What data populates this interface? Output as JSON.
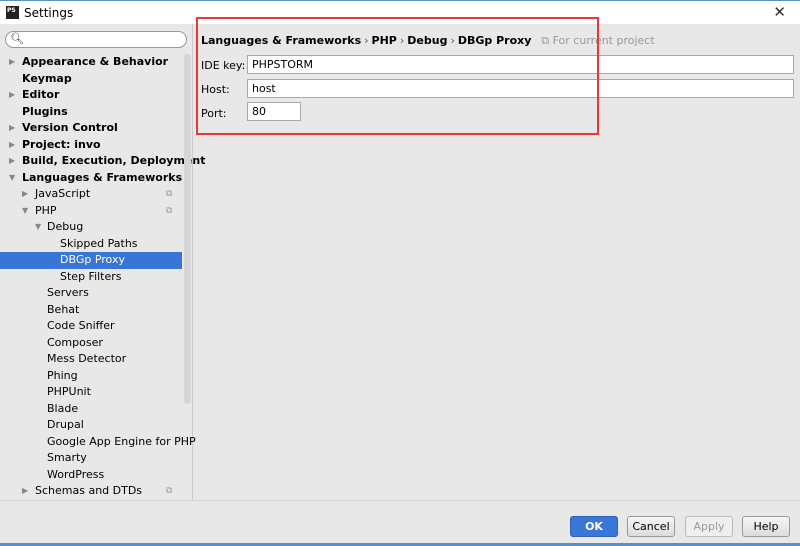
{
  "window": {
    "title": "Settings",
    "icon": "phpstorm-logo",
    "logo_text": "PS"
  },
  "sidebar": {
    "search": {
      "placeholder": "",
      "value": ""
    },
    "items": [
      {
        "label": "Appearance & Behavior",
        "level": 0,
        "bold": true,
        "arrow": "right"
      },
      {
        "label": "Keymap",
        "level": 0,
        "bold": true,
        "arrow": ""
      },
      {
        "label": "Editor",
        "level": 0,
        "bold": true,
        "arrow": "right"
      },
      {
        "label": "Plugins",
        "level": 0,
        "bold": true,
        "arrow": ""
      },
      {
        "label": "Version Control",
        "level": 0,
        "bold": true,
        "arrow": "right"
      },
      {
        "label": "Project: invo",
        "level": 0,
        "bold": true,
        "arrow": "right"
      },
      {
        "label": "Build, Execution, Deployment",
        "level": 0,
        "bold": true,
        "arrow": "right"
      },
      {
        "label": "Languages & Frameworks",
        "level": 0,
        "bold": true,
        "arrow": "down"
      },
      {
        "label": "JavaScript",
        "level": 1,
        "arrow": "right",
        "project": true
      },
      {
        "label": "PHP",
        "level": 1,
        "arrow": "down",
        "project": true
      },
      {
        "label": "Debug",
        "level": 2,
        "arrow": "down"
      },
      {
        "label": "Skipped Paths",
        "level": 3,
        "arrow": ""
      },
      {
        "label": "DBGp Proxy",
        "level": 3,
        "arrow": "",
        "selected": true
      },
      {
        "label": "Step Filters",
        "level": 3,
        "arrow": ""
      },
      {
        "label": "Servers",
        "level": 2,
        "arrow": ""
      },
      {
        "label": "Behat",
        "level": 2,
        "arrow": ""
      },
      {
        "label": "Code Sniffer",
        "level": 2,
        "arrow": ""
      },
      {
        "label": "Composer",
        "level": 2,
        "arrow": ""
      },
      {
        "label": "Mess Detector",
        "level": 2,
        "arrow": ""
      },
      {
        "label": "Phing",
        "level": 2,
        "arrow": ""
      },
      {
        "label": "PHPUnit",
        "level": 2,
        "arrow": ""
      },
      {
        "label": "Blade",
        "level": 2,
        "arrow": ""
      },
      {
        "label": "Drupal",
        "level": 2,
        "arrow": ""
      },
      {
        "label": "Google App Engine for PHP",
        "level": 2,
        "arrow": ""
      },
      {
        "label": "Smarty",
        "level": 2,
        "arrow": ""
      },
      {
        "label": "WordPress",
        "level": 2,
        "arrow": ""
      },
      {
        "label": "Schemas and DTDs",
        "level": 1,
        "arrow": "right",
        "project": true
      }
    ]
  },
  "main": {
    "breadcrumb": [
      "Languages & Frameworks",
      "PHP",
      "Debug",
      "DBGp Proxy"
    ],
    "breadcrumb_note": "For current project",
    "fields": [
      {
        "label": "IDE key:",
        "value": "PHPSTORM"
      },
      {
        "label": "Host:",
        "value": "host"
      },
      {
        "label": "Port:",
        "value": "80"
      }
    ]
  },
  "footer": {
    "ok": "OK",
    "cancel": "Cancel",
    "apply": "Apply",
    "help": "Help"
  },
  "colors": {
    "selection": "#3875d7",
    "highlight_box": "#e8383a",
    "ok_button": "#3a77d8"
  }
}
